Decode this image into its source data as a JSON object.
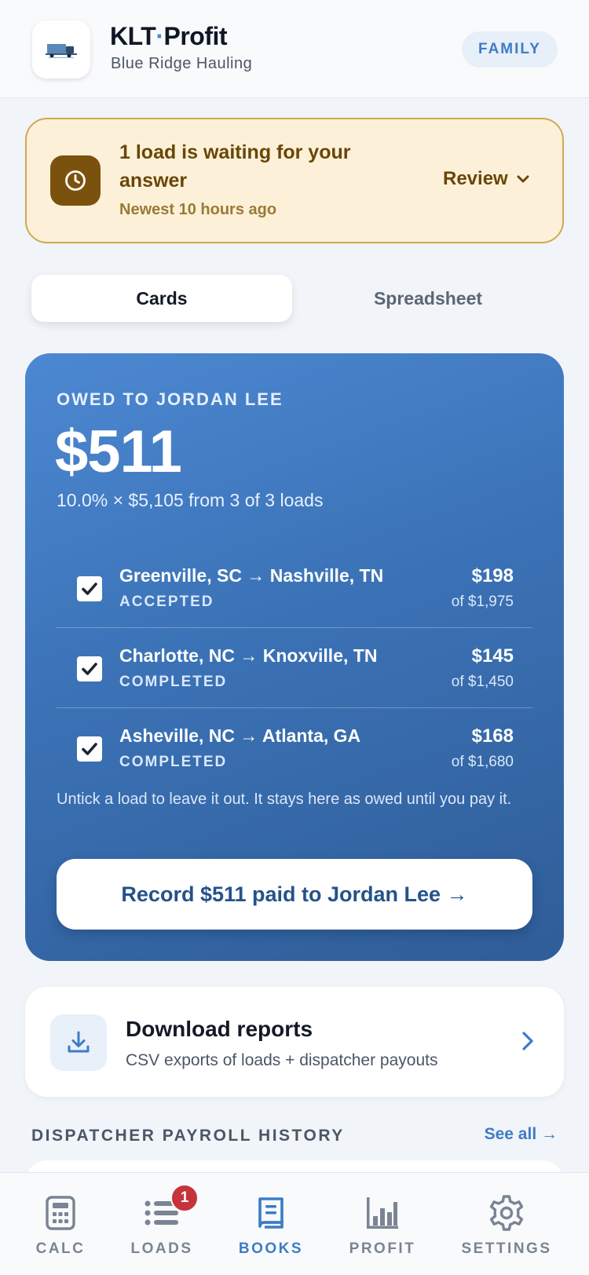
{
  "header": {
    "title_part1": "KLT",
    "title_dot": "·",
    "title_part2": "Profit",
    "subtitle": "Blue Ridge Hauling",
    "badge": "FAMILY"
  },
  "waiting": {
    "title": "1 load is waiting for your answer",
    "subtitle": "Newest 10 hours ago",
    "review_label": "Review"
  },
  "view_tabs": [
    {
      "label": "Cards",
      "active": true
    },
    {
      "label": "Spreadsheet",
      "active": false
    }
  ],
  "owed": {
    "label": "OWED TO JORDAN LEE",
    "amount": "$511",
    "detail": "10.0% × $5,105 from 3 of 3 loads",
    "loads": [
      {
        "route": "Greenville, SC → Nashville, TN",
        "status": "ACCEPTED",
        "pay": "$198",
        "of_total": "of $1,975",
        "checked": true
      },
      {
        "route": "Charlotte, NC → Knoxville, TN",
        "status": "COMPLETED",
        "pay": "$145",
        "of_total": "of $1,450",
        "checked": true
      },
      {
        "route": "Asheville, NC → Atlanta, GA",
        "status": "COMPLETED",
        "pay": "$168",
        "of_total": "of $1,680",
        "checked": true
      }
    ],
    "note": "Untick a load to leave it out. It stays here as owed until you pay it.",
    "record_label": "Record $511 paid to Jordan Lee →"
  },
  "download": {
    "title": "Download reports",
    "subtitle": "CSV exports of loads + dispatcher payouts"
  },
  "payroll": {
    "heading": "DISPATCHER PAYROLL HISTORY",
    "see_all": "See all →"
  },
  "nav": {
    "items": [
      {
        "label": "CALC",
        "icon": "calculator-icon",
        "active": false
      },
      {
        "label": "LOADS",
        "icon": "list-icon",
        "active": false,
        "badge": "1"
      },
      {
        "label": "BOOKS",
        "icon": "book-icon",
        "active": true
      },
      {
        "label": "PROFIT",
        "icon": "bar-chart-icon",
        "active": false
      },
      {
        "label": "SETTINGS",
        "icon": "gear-icon",
        "active": false
      }
    ]
  },
  "colors": {
    "accent": "#3d7cc6",
    "warning_bg": "#fcf1d8",
    "warning_text": "#6a4609",
    "badge_red": "#c5343b"
  }
}
